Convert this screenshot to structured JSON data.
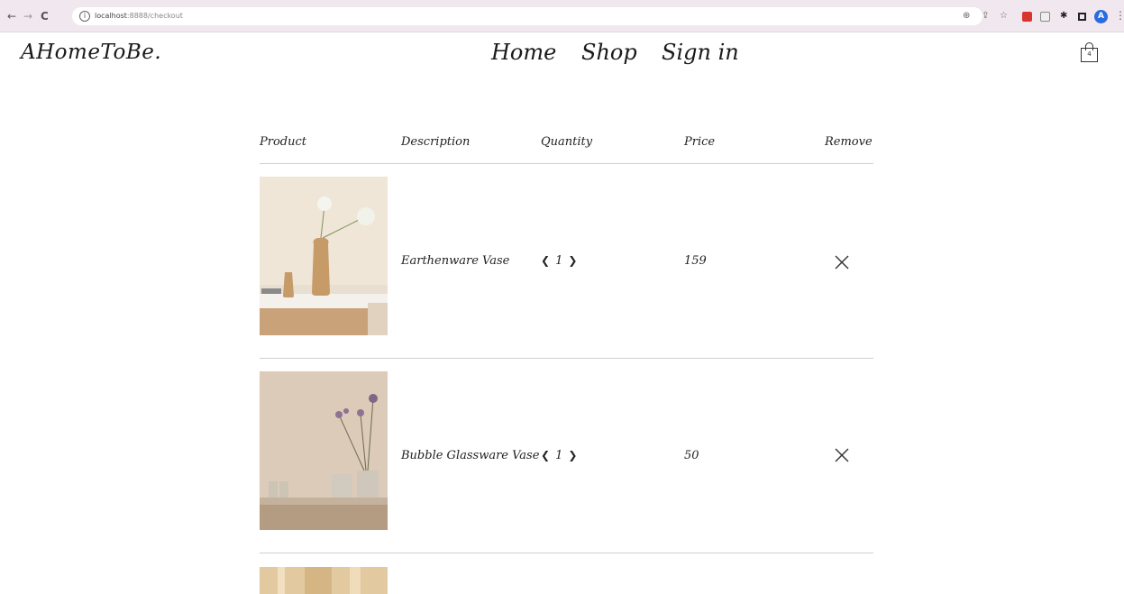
{
  "browser": {
    "back_glyph": "←",
    "forward_glyph": "→",
    "reload_glyph": "C",
    "info_glyph": "i",
    "url_host": "localhost",
    "url_rest": ":8888/checkout",
    "zoom_glyph": "⊕",
    "share_glyph": "⇪",
    "star_glyph": "☆",
    "pin_glyph": "✱",
    "avatar_letter": "A",
    "menu_glyph": "⋮"
  },
  "site": {
    "brand": "AHomeToBe.",
    "nav": [
      "Home",
      "Shop",
      "Sign in"
    ],
    "cart_count": "4"
  },
  "table": {
    "headers": [
      "Product",
      "Description",
      "Quantity",
      "Price",
      "Remove"
    ],
    "rows": [
      {
        "description": "Earthenware Vase",
        "quantity": "1",
        "price": "159",
        "image": "earthenware-vase-photo"
      },
      {
        "description": "Bubble Glassware Vase",
        "quantity": "1",
        "price": "50",
        "image": "bubble-glassware-vase-photo"
      }
    ],
    "qty_prev": "❮",
    "qty_next": "❯"
  },
  "colors": {
    "chrome_bg": "#f1e8ef",
    "divider": "#cfcfcf",
    "text": "#222222"
  }
}
